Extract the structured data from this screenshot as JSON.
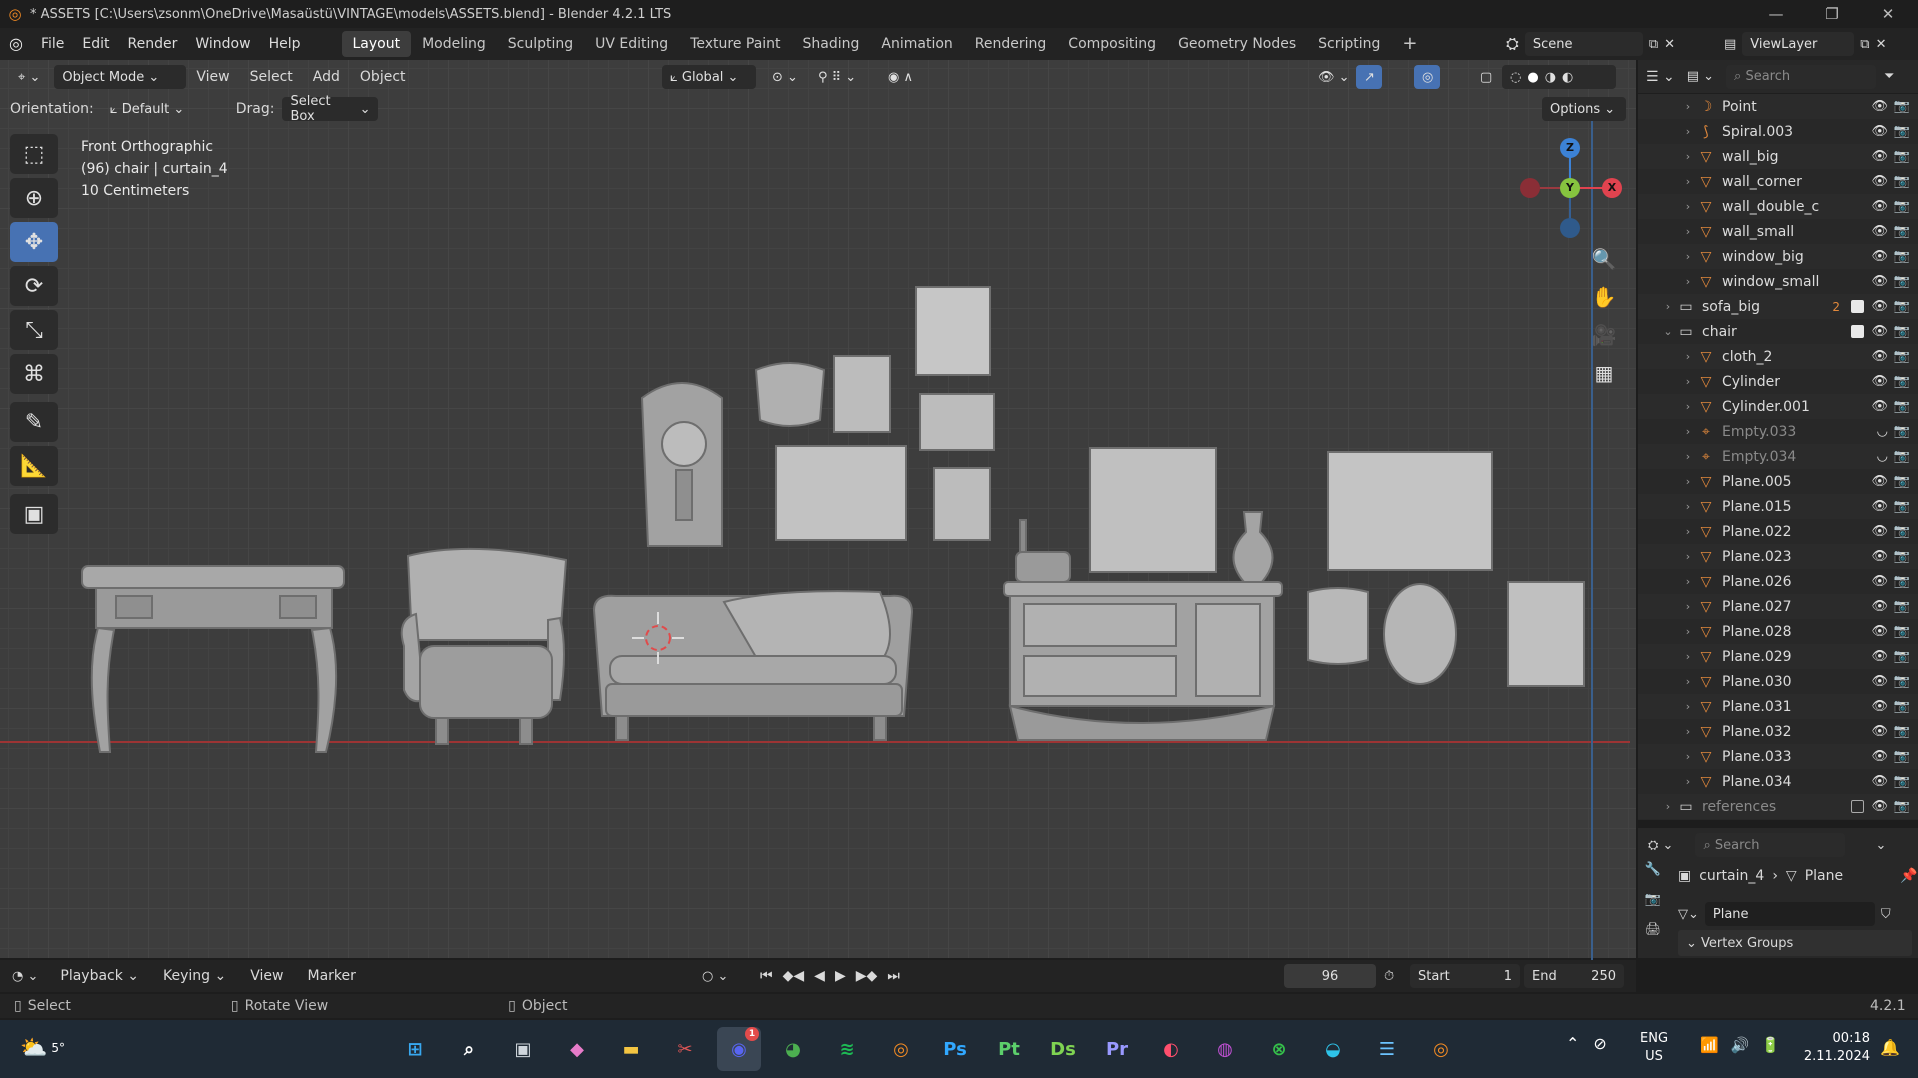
{
  "titlebar": {
    "title": "* ASSETS [C:\\Users\\zsonm\\OneDrive\\Masaüstü\\VINTAGE\\models\\ASSETS.blend] - Blender 4.2.1 LTS"
  },
  "menu": [
    "File",
    "Edit",
    "Render",
    "Window",
    "Help"
  ],
  "workspaces": [
    "Layout",
    "Modeling",
    "Sculpting",
    "UV Editing",
    "Texture Paint",
    "Shading",
    "Animation",
    "Rendering",
    "Compositing",
    "Geometry Nodes",
    "Scripting"
  ],
  "active_workspace": "Layout",
  "scene_name": "Scene",
  "viewlayer_name": "ViewLayer",
  "viewport_header": {
    "mode": "Object Mode",
    "menus": [
      "View",
      "Select",
      "Add",
      "Object"
    ],
    "transform": "Global"
  },
  "options_bar": {
    "orientation_label": "Orientation:",
    "orientation_value": "Default",
    "drag_label": "Drag:",
    "drag_value": "Select Box",
    "options": "Options"
  },
  "viewport_info": {
    "view": "Front Orthographic",
    "object": "(96) chair | curtain_4",
    "scale": "10 Centimeters"
  },
  "gizmo": {
    "z": "Z",
    "y": "Y",
    "x": "X"
  },
  "outliner": {
    "search_placeholder": "Search",
    "rows": [
      {
        "name": "Point",
        "type": "light",
        "indent": 2
      },
      {
        "name": "Spiral.003",
        "type": "curve",
        "indent": 2
      },
      {
        "name": "wall_big",
        "type": "mesh",
        "indent": 2
      },
      {
        "name": "wall_corner",
        "type": "mesh",
        "indent": 2
      },
      {
        "name": "wall_double_c",
        "type": "mesh",
        "indent": 2
      },
      {
        "name": "wall_small",
        "type": "mesh",
        "indent": 2
      },
      {
        "name": "window_big",
        "type": "mesh",
        "indent": 2
      },
      {
        "name": "window_small",
        "type": "mesh",
        "indent": 2
      },
      {
        "name": "sofa_big",
        "type": "collection",
        "indent": 1,
        "badge": "2"
      },
      {
        "name": "chair",
        "type": "collection",
        "indent": 1
      },
      {
        "name": "cloth_2",
        "type": "mesh",
        "indent": 2
      },
      {
        "name": "Cylinder",
        "type": "mesh",
        "indent": 2
      },
      {
        "name": "Cylinder.001",
        "type": "mesh",
        "indent": 2
      },
      {
        "name": "Empty.033",
        "type": "empty",
        "indent": 2
      },
      {
        "name": "Empty.034",
        "type": "empty",
        "indent": 2
      },
      {
        "name": "Plane.005",
        "type": "mesh",
        "indent": 2
      },
      {
        "name": "Plane.015",
        "type": "mesh",
        "indent": 2
      },
      {
        "name": "Plane.022",
        "type": "mesh",
        "indent": 2
      },
      {
        "name": "Plane.023",
        "type": "mesh",
        "indent": 2
      },
      {
        "name": "Plane.026",
        "type": "mesh",
        "indent": 2
      },
      {
        "name": "Plane.027",
        "type": "mesh",
        "indent": 2
      },
      {
        "name": "Plane.028",
        "type": "mesh",
        "indent": 2
      },
      {
        "name": "Plane.029",
        "type": "mesh",
        "indent": 2
      },
      {
        "name": "Plane.030",
        "type": "mesh",
        "indent": 2
      },
      {
        "name": "Plane.031",
        "type": "mesh",
        "indent": 2
      },
      {
        "name": "Plane.032",
        "type": "mesh",
        "indent": 2
      },
      {
        "name": "Plane.033",
        "type": "mesh",
        "indent": 2
      },
      {
        "name": "Plane.034",
        "type": "mesh",
        "indent": 2
      },
      {
        "name": "references",
        "type": "collection",
        "indent": 1
      }
    ]
  },
  "properties": {
    "search_placeholder": "Search",
    "breadcrumb_object": "curtain_4",
    "breadcrumb_data": "Plane",
    "data_name": "Plane",
    "panel": "Vertex Groups"
  },
  "timeline": {
    "menus": [
      "Playback",
      "Keying",
      "View",
      "Marker"
    ],
    "current_frame": "96",
    "start_label": "Start",
    "start": "1",
    "end_label": "End",
    "end": "250"
  },
  "statusbar": {
    "select": "Select",
    "rotate": "Rotate View",
    "object": "Object",
    "version": "4.2.1"
  },
  "taskbar": {
    "weather_temp": "5°",
    "apps": [
      {
        "name": "windows",
        "glyph": "⊞",
        "color": "#38a8f0"
      },
      {
        "name": "search",
        "glyph": "⌕",
        "color": "#ffffff"
      },
      {
        "name": "task-view",
        "glyph": "▣",
        "color": "#cfd6dc"
      },
      {
        "name": "copilot",
        "glyph": "◆",
        "color": "#e67cc9"
      },
      {
        "name": "file-explorer",
        "glyph": "▬",
        "color": "#f4c542"
      },
      {
        "name": "snipping-tool",
        "glyph": "✂",
        "color": "#e05656"
      },
      {
        "name": "discord",
        "glyph": "◉",
        "color": "#5865f2"
      },
      {
        "name": "chrome",
        "glyph": "◕",
        "color": "#4caf50"
      },
      {
        "name": "spotify",
        "glyph": "≋",
        "color": "#1db954"
      },
      {
        "name": "blender-1",
        "glyph": "◎",
        "color": "#f08a24"
      },
      {
        "name": "photoshop",
        "glyph": "Ps",
        "color": "#31a8ff"
      },
      {
        "name": "substance-painter",
        "glyph": "Pt",
        "color": "#5ccf6b"
      },
      {
        "name": "substance-designer",
        "glyph": "Ds",
        "color": "#7fd352"
      },
      {
        "name": "premiere",
        "glyph": "Pr",
        "color": "#9999ff"
      },
      {
        "name": "creative-cloud",
        "glyph": "◐",
        "color": "#ff4f6d"
      },
      {
        "name": "instagram",
        "glyph": "◍",
        "color": "#c150d4"
      },
      {
        "name": "xbox",
        "glyph": "⊗",
        "color": "#35c04a"
      },
      {
        "name": "edge",
        "glyph": "◒",
        "color": "#2ec4ea"
      },
      {
        "name": "notepad",
        "glyph": "☰",
        "color": "#6cc3ff"
      },
      {
        "name": "blender-2",
        "glyph": "◎",
        "color": "#f08a24"
      }
    ],
    "discord_badge": "1",
    "lang": "ENG",
    "region": "US",
    "time": "00:18",
    "date": "2.11.2024"
  },
  "colors": {
    "accent": "#4772b3",
    "x_axis": "#e0434f",
    "y_axis": "#86c43f",
    "z_axis": "#3c82d6",
    "object_orange": "#e2893c"
  }
}
